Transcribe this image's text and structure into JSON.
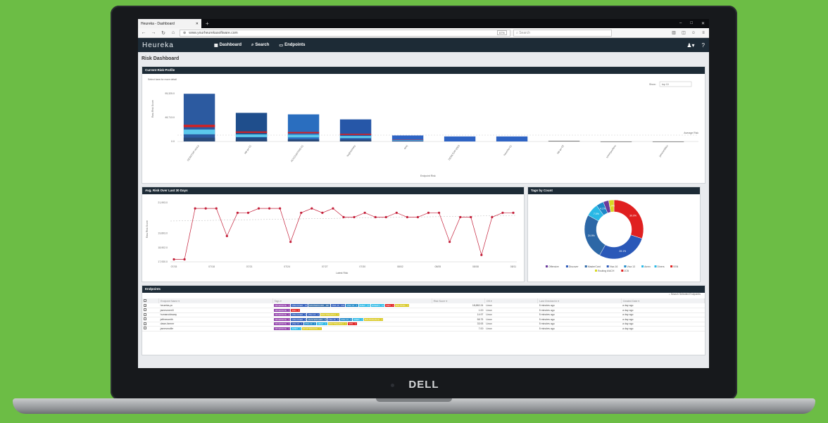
{
  "browser": {
    "tab_title": "Heureka - Dashboard",
    "url": "www.yourheurekasoftware.com",
    "zoom": "67%",
    "search_placeholder": "Search"
  },
  "app": {
    "logo": "Heureka",
    "nav": [
      "Dashboard",
      "Search",
      "Endpoints"
    ]
  },
  "page_title": "Risk Dashboard",
  "risk_panel": {
    "title": "Current Risk Profile",
    "hint": "Select bars for more detail",
    "show_label": "Show:",
    "show_value": "top 10",
    "chart_data": {
      "type": "bar",
      "ylabel": "Raw Risk Score",
      "xlabel": "Endpoint Risk",
      "yticks": [
        "95,325.0",
        "48,713.0",
        "0.0"
      ],
      "ylim": [
        0,
        95325
      ],
      "avg_label": "Average Risk",
      "categories": [
        "DESKTOP-XXXX",
        "lab-pc-01",
        "ACCOUNTING-01",
        "hughesmary",
        "anuj",
        "DESKTOP-0003",
        "heureka-01",
        "lab-pc-02",
        "tommywolters",
        "jamesmillikin"
      ],
      "values": [
        95000,
        57000,
        54000,
        44000,
        12000,
        10000,
        10000,
        1000,
        0,
        0
      ],
      "colors": [
        "#2c5aa0",
        "#1f4e8c",
        "#2a6ebf",
        "#2657a8",
        "#2f64c4",
        "#2f64c4",
        "#2f64c4",
        "#444",
        "#444",
        "#444"
      ]
    }
  },
  "avg_panel": {
    "title": "Avg. Risk Over Last 30 Days",
    "chart_data": {
      "type": "line",
      "ylabel": "Raw Risk Score",
      "xlabel": "Latest Risk",
      "yticks": [
        "21,993.0",
        "19,893.0",
        "18,902.0",
        "17,930.0"
      ],
      "ylim": [
        17930,
        21993
      ],
      "xticks": [
        "07/15",
        "07/18",
        "07/21",
        "07/24",
        "07/27",
        "07/30",
        "08/02",
        "08/05",
        "08/08",
        "08/11"
      ],
      "values": [
        18100,
        18100,
        21600,
        21600,
        21600,
        19700,
        21300,
        21300,
        21600,
        21600,
        21600,
        19300,
        21300,
        21600,
        21300,
        21600,
        21000,
        21000,
        21300,
        21000,
        21000,
        21300,
        21000,
        21000,
        21300,
        21300,
        19300,
        21000,
        21000,
        18400,
        21000,
        21300,
        21300
      ]
    }
  },
  "tags_panel": {
    "title": "Tags by Count",
    "chart_data": {
      "type": "pie",
      "values": [
        30.0,
        28.1,
        24.9,
        7.0,
        4.1,
        3.0,
        2.9
      ],
      "labels": [
        "30.0%",
        "28.1%",
        "24.9%",
        "7.0%",
        "4.1%",
        "",
        "1.9%"
      ],
      "colors": [
        "#e02020",
        "#2a58b8",
        "#2c67a6",
        "#29b8e6",
        "#1e88c8",
        "#6a3a9c",
        "#d8d820"
      ],
      "legend": [
        "Offensive",
        "Discover",
        "MasterCard",
        "Visa 16",
        "Visa 13",
        "Amex",
        "Diners",
        "SSN",
        "Routing #/ACH",
        "JCB"
      ],
      "legend_colors": [
        "#6a3a9c",
        "#2a58b8",
        "#2c67a6",
        "#2a58b8",
        "#1e88c8",
        "#29b8e6",
        "#29b8e6",
        "#e02020",
        "#d8d820",
        "#e02020"
      ]
    }
  },
  "endpoints": {
    "title": "Endpoints",
    "search_label": "Search Selected Endpoints",
    "columns": [
      "Endpoint Name",
      "Tags",
      "Risk Score",
      "OS",
      "Last Checked in",
      "Created Date"
    ],
    "rows": [
      {
        "name": "heureka-pc",
        "score": "18,882.24",
        "os": "Linux",
        "checked": "5 minutes ago",
        "created": "a day ago",
        "tags": [
          "OFFENSIVE - 4",
          "DISCOVER - 14",
          "MASTERCARD - 487",
          "VISA 16 - 233",
          "VISA 13 - 1",
          "AMEX - 23",
          "DINERS - 16",
          "SSN - 1",
          "ROUTING - 1"
        ],
        "checked_box": true
      },
      {
        "name": "jamesmerrill",
        "score": "1.00",
        "os": "Linux",
        "checked": "5 minutes ago",
        "created": "a day ago",
        "tags": [
          "OFFENSIVE - 1",
          "SSN - 1"
        ],
        "checked_box": false
      },
      {
        "name": "humanoidsway",
        "score": "14.97",
        "os": "Linux",
        "checked": "5 minutes ago",
        "created": "a day ago",
        "tags": [
          "OFFENSIVE - 4",
          "DISCOVER - 4",
          "VISA 16 - 2",
          "ROUTING/ACH - 1"
        ],
        "checked_box": false
      },
      {
        "name": "jeffreesmith",
        "score": "58.75",
        "os": "Linux",
        "checked": "5 minutes ago",
        "created": "a day ago",
        "tags": [
          "OFFENSIVE - 4",
          "DISCOVER - 4",
          "MASTERCARD - 6",
          "VISA 16 - 6",
          "VISA 13 - 1",
          "AMEX - 1",
          "ROUTING/ACH - 1"
        ],
        "checked_box": false
      },
      {
        "name": "dawn-farmer",
        "score": "33.93",
        "os": "Linux",
        "checked": "5 minutes ago",
        "created": "a day ago",
        "tags": [
          "OFFENSIVE - 1",
          "VISA 16 - 1",
          "VISA 13 - 1",
          "AMEX - 1",
          "ROUTING/ACH - 1",
          "SSN - 1"
        ],
        "checked_box": false
      },
      {
        "name": "jamesmollie",
        "score": "7.00",
        "os": "Linux",
        "checked": "5 minutes ago",
        "created": "a day ago",
        "tags": [
          "OFFENSIVE - 4",
          "AMEX - 1",
          "ROUTING/ACH - 1"
        ],
        "checked_box": false
      }
    ]
  },
  "laptop_brand": "DELL"
}
